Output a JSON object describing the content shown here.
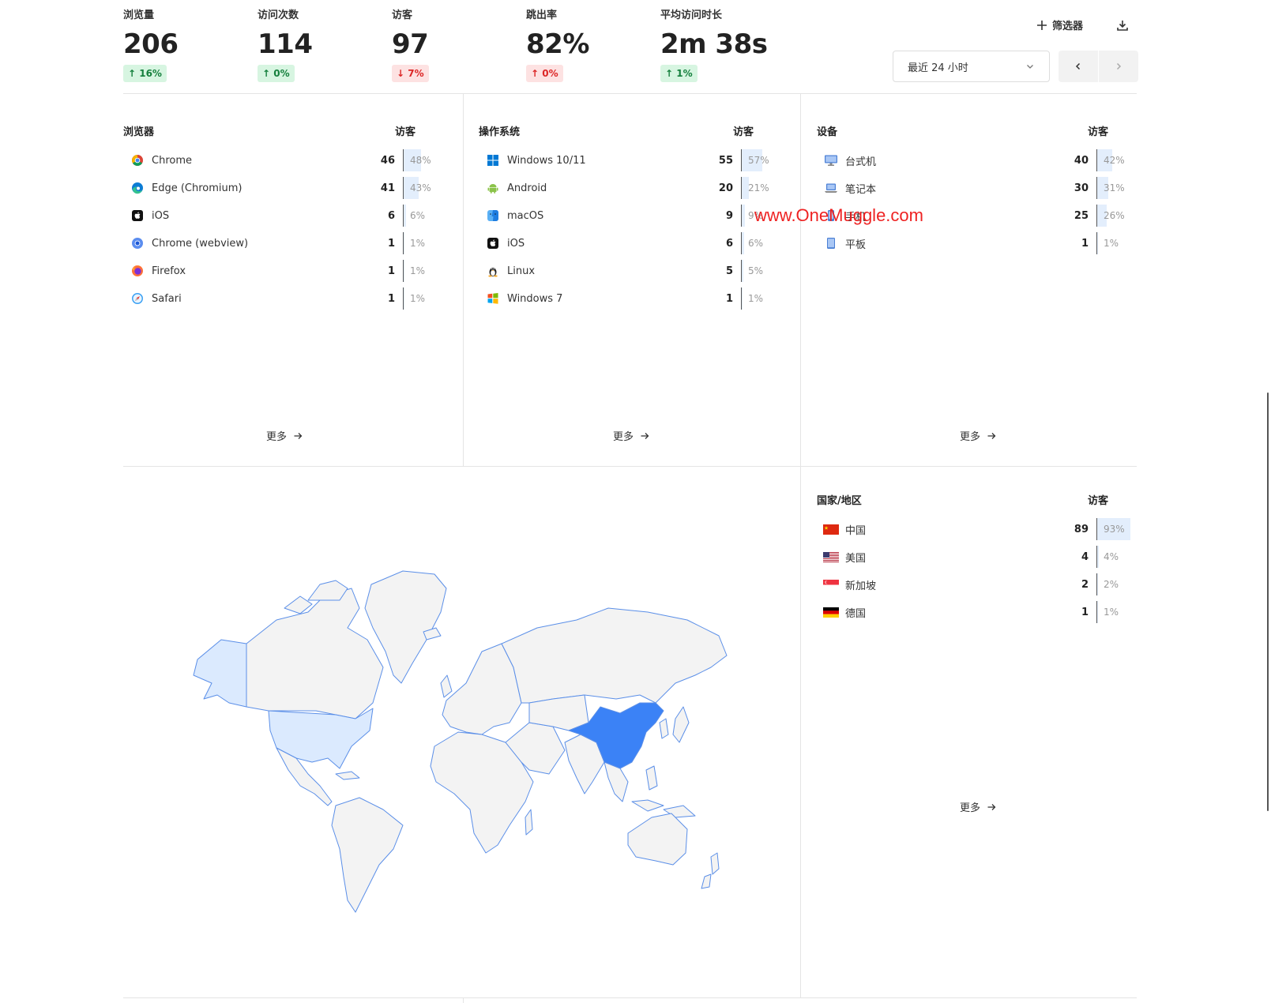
{
  "metrics": [
    {
      "label": "浏览量",
      "value": "206",
      "change": "↑ 16%",
      "dir": "up"
    },
    {
      "label": "访问次数",
      "value": "114",
      "change": "↑ 0%",
      "dir": "up"
    },
    {
      "label": "访客",
      "value": "97",
      "change": "↓ 7%",
      "dir": "down"
    },
    {
      "label": "跳出率",
      "value": "82%",
      "change": "↑ 0%",
      "dir": "down"
    },
    {
      "label": "平均访问时长",
      "value": "2m 38s",
      "change": "↑ 1%",
      "dir": "up"
    }
  ],
  "toolbar": {
    "filter_label": "筛选器",
    "range_label": "最近 24 小时"
  },
  "browsers": {
    "title": "浏览器",
    "col": "访客",
    "more": "更多",
    "rows": [
      {
        "name": "Chrome",
        "count": "46",
        "pct": "48%",
        "frac": 0.48,
        "icon": "chrome-icon"
      },
      {
        "name": "Edge (Chromium)",
        "count": "41",
        "pct": "43%",
        "frac": 0.43,
        "icon": "edge-icon"
      },
      {
        "name": "iOS",
        "count": "6",
        "pct": "6%",
        "frac": 0.06,
        "icon": "apple-icon"
      },
      {
        "name": "Chrome (webview)",
        "count": "1",
        "pct": "1%",
        "frac": 0.01,
        "icon": "chrome-webview-icon"
      },
      {
        "name": "Firefox",
        "count": "1",
        "pct": "1%",
        "frac": 0.01,
        "icon": "firefox-icon"
      },
      {
        "name": "Safari",
        "count": "1",
        "pct": "1%",
        "frac": 0.01,
        "icon": "safari-icon"
      }
    ]
  },
  "os": {
    "title": "操作系统",
    "col": "访客",
    "more": "更多",
    "rows": [
      {
        "name": "Windows 10/11",
        "count": "55",
        "pct": "57%",
        "frac": 0.57,
        "icon": "windows-icon"
      },
      {
        "name": "Android",
        "count": "20",
        "pct": "21%",
        "frac": 0.21,
        "icon": "android-icon"
      },
      {
        "name": "macOS",
        "count": "9",
        "pct": "9%",
        "frac": 0.09,
        "icon": "macos-icon"
      },
      {
        "name": "iOS",
        "count": "6",
        "pct": "6%",
        "frac": 0.06,
        "icon": "apple-icon"
      },
      {
        "name": "Linux",
        "count": "5",
        "pct": "5%",
        "frac": 0.05,
        "icon": "linux-icon"
      },
      {
        "name": "Windows 7",
        "count": "1",
        "pct": "1%",
        "frac": 0.01,
        "icon": "windows7-icon"
      }
    ]
  },
  "devices": {
    "title": "设备",
    "col": "访客",
    "more": "更多",
    "rows": [
      {
        "name": "台式机",
        "count": "40",
        "pct": "42%",
        "frac": 0.42,
        "icon": "desktop-icon"
      },
      {
        "name": "笔记本",
        "count": "30",
        "pct": "31%",
        "frac": 0.31,
        "icon": "laptop-icon"
      },
      {
        "name": "手机",
        "count": "25",
        "pct": "26%",
        "frac": 0.26,
        "icon": "mobile-icon"
      },
      {
        "name": "平板",
        "count": "1",
        "pct": "1%",
        "frac": 0.01,
        "icon": "tablet-icon"
      }
    ]
  },
  "countries": {
    "title": "国家/地区",
    "col": "访客",
    "more": "更多",
    "rows": [
      {
        "name": "中国",
        "count": "89",
        "pct": "93%",
        "frac": 0.93,
        "icon": "flag-cn-icon"
      },
      {
        "name": "美国",
        "count": "4",
        "pct": "4%",
        "frac": 0.04,
        "icon": "flag-us-icon"
      },
      {
        "name": "新加坡",
        "count": "2",
        "pct": "2%",
        "frac": 0.02,
        "icon": "flag-sg-icon"
      },
      {
        "name": "德国",
        "count": "1",
        "pct": "1%",
        "frac": 0.01,
        "icon": "flag-de-icon"
      }
    ]
  },
  "map": {
    "highlight_strong": "#3b82f6",
    "highlight_light": "#dbeafe",
    "land": "#f3f3f3",
    "border": "#5b8fe8"
  },
  "watermark": "www.OneMuggle.com"
}
